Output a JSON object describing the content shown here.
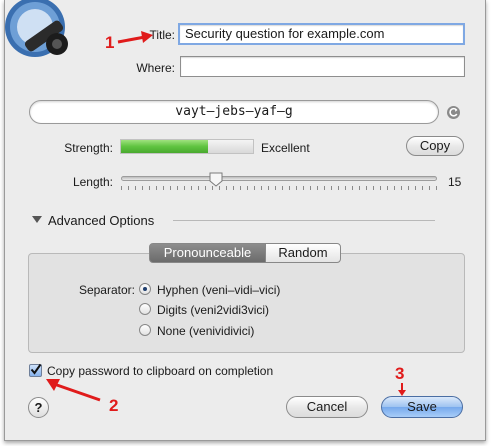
{
  "form": {
    "title_label": "Title:",
    "title_value": "Security question for example.com",
    "where_label": "Where:",
    "where_value": ""
  },
  "generator": {
    "password": "vayt–jebs–yaf–g",
    "strength_label": "Strength:",
    "strength_value": "Excellent",
    "strength_fraction": 0.66,
    "copy_label": "Copy",
    "length_label": "Length:",
    "length_value": "15",
    "length_min": 1,
    "length_max": 15
  },
  "advanced": {
    "toggle_label": "Advanced Options",
    "segments": [
      "Pronounceable",
      "Random"
    ],
    "selected_segment": "Pronounceable",
    "separator_label": "Separator:",
    "options": [
      {
        "label": "Hyphen (veni–vidi–vici)",
        "selected": true
      },
      {
        "label": "Digits (veni2vidi3vici)",
        "selected": false
      },
      {
        "label": "None (venividivici)",
        "selected": false
      }
    ]
  },
  "footer": {
    "clipboard_label": "Copy password to clipboard on completion",
    "clipboard_checked": true,
    "help_label": "?",
    "cancel_label": "Cancel",
    "save_label": "Save"
  },
  "annotations": {
    "one": "1",
    "two": "2",
    "three": "3"
  },
  "colors": {
    "annotation": "#e01b1b",
    "strength_bar": "#5fc440",
    "accent": "#76a9ec"
  }
}
